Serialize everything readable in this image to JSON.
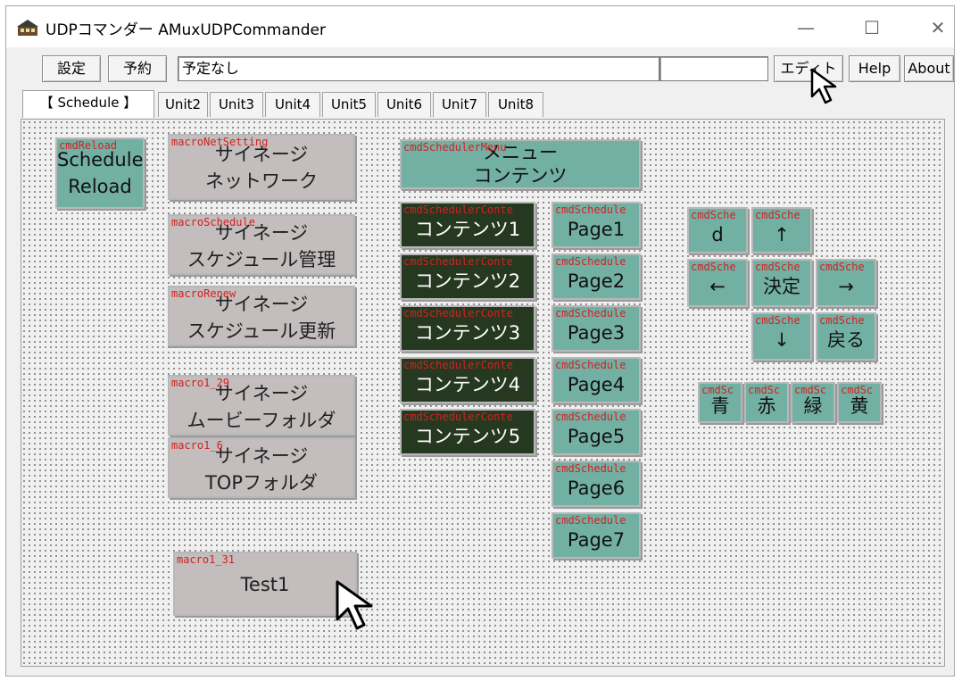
{
  "window": {
    "title": "UDPコマンダー AMuxUDPCommander"
  },
  "controls_bar": {
    "settings": "設定",
    "reserve": "予約",
    "schedule_field": "予定なし",
    "status_field": "",
    "edit": "エディト",
    "help": "Help",
    "about": "About"
  },
  "tabs": [
    "【 Schedule 】",
    "Unit2",
    "Unit3",
    "Unit4",
    "Unit5",
    "Unit6",
    "Unit7",
    "Unit8"
  ],
  "colors": {
    "gray": "#c3bdbd",
    "teal": "#73b0a4",
    "dark": "#24391f",
    "name_text": "#d22222"
  },
  "buttons": {
    "reload": {
      "name": "cmdReload",
      "lines": [
        "Schedule",
        "Reload"
      ]
    },
    "network": {
      "name": "macroNetSetting",
      "lines": [
        "サイネージ",
        "ネットワーク"
      ]
    },
    "schedule_mgmt": {
      "name": "macroSchedule",
      "lines": [
        "サイネージ",
        "スケジュール管理"
      ]
    },
    "schedule_renew": {
      "name": "macroRenew",
      "lines": [
        "サイネージ",
        "スケジュール更新"
      ]
    },
    "movie_folder": {
      "name": "macro1_29",
      "lines": [
        "サイネージ",
        "ムービーフォルダ"
      ]
    },
    "top_folder": {
      "name": "macro1_6",
      "lines": [
        "サイネージ",
        "TOPフォルダ"
      ]
    },
    "test1": {
      "name": "macro1_31",
      "lines": [
        "Test1"
      ]
    },
    "menu": {
      "name": "cmdSchedulerMenu",
      "lines": [
        "メニュー",
        "コンテンツ"
      ]
    },
    "contents": [
      {
        "name": "cmdSchedulerConte",
        "label": "コンテンツ1"
      },
      {
        "name": "cmdSchedulerConte",
        "label": "コンテンツ2"
      },
      {
        "name": "cmdSchedulerConte",
        "label": "コンテンツ3"
      },
      {
        "name": "cmdSchedulerConte",
        "label": "コンテンツ4"
      },
      {
        "name": "cmdSchedulerConte",
        "label": "コンテンツ5"
      }
    ],
    "pages": [
      {
        "name": "cmdSchedule",
        "label": "Page1"
      },
      {
        "name": "cmdSchedule",
        "label": "Page2"
      },
      {
        "name": "cmdSchedule",
        "label": "Page3"
      },
      {
        "name": "cmdSchedule",
        "label": "Page4"
      },
      {
        "name": "cmdSchedule",
        "label": "Page5"
      },
      {
        "name": "cmdSchedule",
        "label": "Page6"
      },
      {
        "name": "cmdSchedule",
        "label": "Page7"
      }
    ],
    "nav": {
      "d": {
        "name": "cmdSche",
        "label": "d"
      },
      "up": {
        "name": "cmdSche",
        "label": "↑"
      },
      "left": {
        "name": "cmdSche",
        "label": "←"
      },
      "ok": {
        "name": "cmdSche",
        "label": "決定"
      },
      "right": {
        "name": "cmdSche",
        "label": "→"
      },
      "down": {
        "name": "cmdSche",
        "label": "↓"
      },
      "back": {
        "name": "cmdSche",
        "label": "戻る"
      }
    },
    "colors_row": [
      {
        "name": "cmdSc",
        "label": "青"
      },
      {
        "name": "cmdSc",
        "label": "赤"
      },
      {
        "name": "cmdSc",
        "label": "緑"
      },
      {
        "name": "cmdSc",
        "label": "黄"
      }
    ]
  }
}
